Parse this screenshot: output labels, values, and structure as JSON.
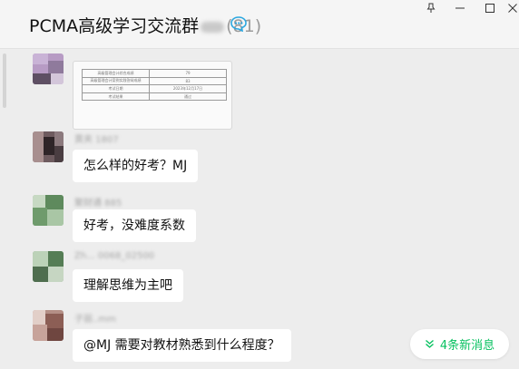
{
  "window": {
    "title": "PCMA高级学习交流群",
    "member_count": "(81)",
    "controls": [
      "pin-icon",
      "minimize-icon",
      "maximize-icon",
      "close-icon"
    ]
  },
  "messages": [
    {
      "type": "image",
      "sender": "",
      "table": [
        [
          "高级管理会计综合成绩",
          "79"
        ],
        [
          "高级管理会计案例实践答辩成绩",
          "83"
        ],
        [
          "考试日期",
          "2023年12月17日"
        ],
        [
          "考试结果",
          "通过"
        ]
      ]
    },
    {
      "type": "text",
      "sender": "黄夹 1807",
      "text": "怎么样的好考？MJ"
    },
    {
      "type": "text",
      "sender": "聚财通 885",
      "text": "好考，没难度系数"
    },
    {
      "type": "text",
      "sender": "Zh...  0068_02500",
      "text": "理解思维为主吧"
    },
    {
      "type": "text",
      "sender": "子丽..mm",
      "text": "@MJ 需要对教材熟悉到什么程度？"
    }
  ],
  "new_messages": {
    "label": "4条新消息",
    "icon": "double-chevron-down-icon"
  },
  "colors": {
    "accent": "#07c160",
    "chat_bg": "#ededed",
    "bubble": "#ffffff"
  }
}
